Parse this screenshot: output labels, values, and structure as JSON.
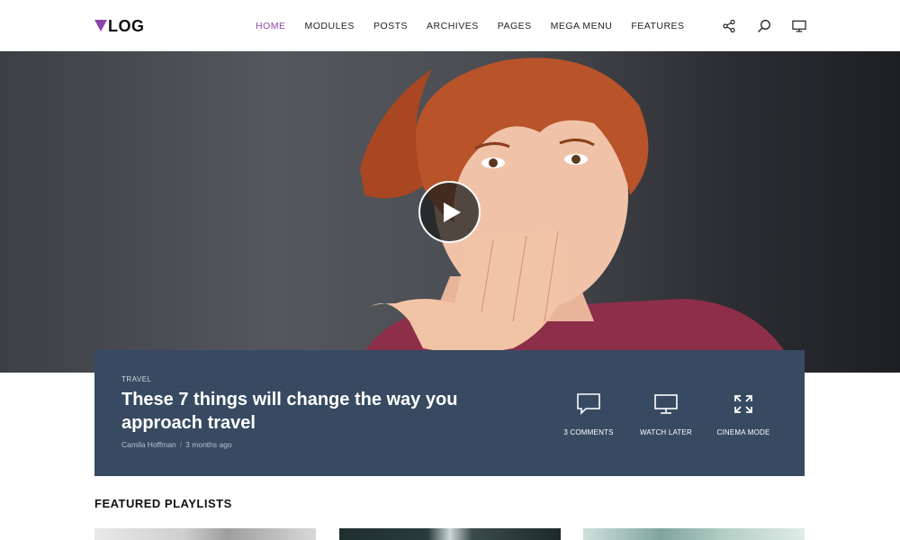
{
  "header": {
    "logo_text": "LOG",
    "nav": [
      {
        "label": "HOME",
        "active": true
      },
      {
        "label": "MODULES",
        "active": false
      },
      {
        "label": "POSTS",
        "active": false
      },
      {
        "label": "ARCHIVES",
        "active": false
      },
      {
        "label": "PAGES",
        "active": false
      },
      {
        "label": "MEGA MENU",
        "active": false
      },
      {
        "label": "FEATURES",
        "active": false
      }
    ],
    "icons": [
      "share-icon",
      "search-icon",
      "monitor-icon"
    ]
  },
  "hero": {
    "play_icon": "play-icon"
  },
  "post": {
    "category": "TRAVEL",
    "title": "These 7 things will change the way you approach travel",
    "author": "Camila Hoffman",
    "separator": "/",
    "date": "3 months ago",
    "actions": [
      {
        "icon": "comment-icon",
        "label": "3 COMMENTS"
      },
      {
        "icon": "monitor-icon",
        "label": "WATCH LATER"
      },
      {
        "icon": "expand-icon",
        "label": "CINEMA MODE"
      }
    ]
  },
  "featured": {
    "heading": "FEATURED PLAYLISTS"
  },
  "colors": {
    "accent": "#8e44ad",
    "panel": "#374a61"
  }
}
